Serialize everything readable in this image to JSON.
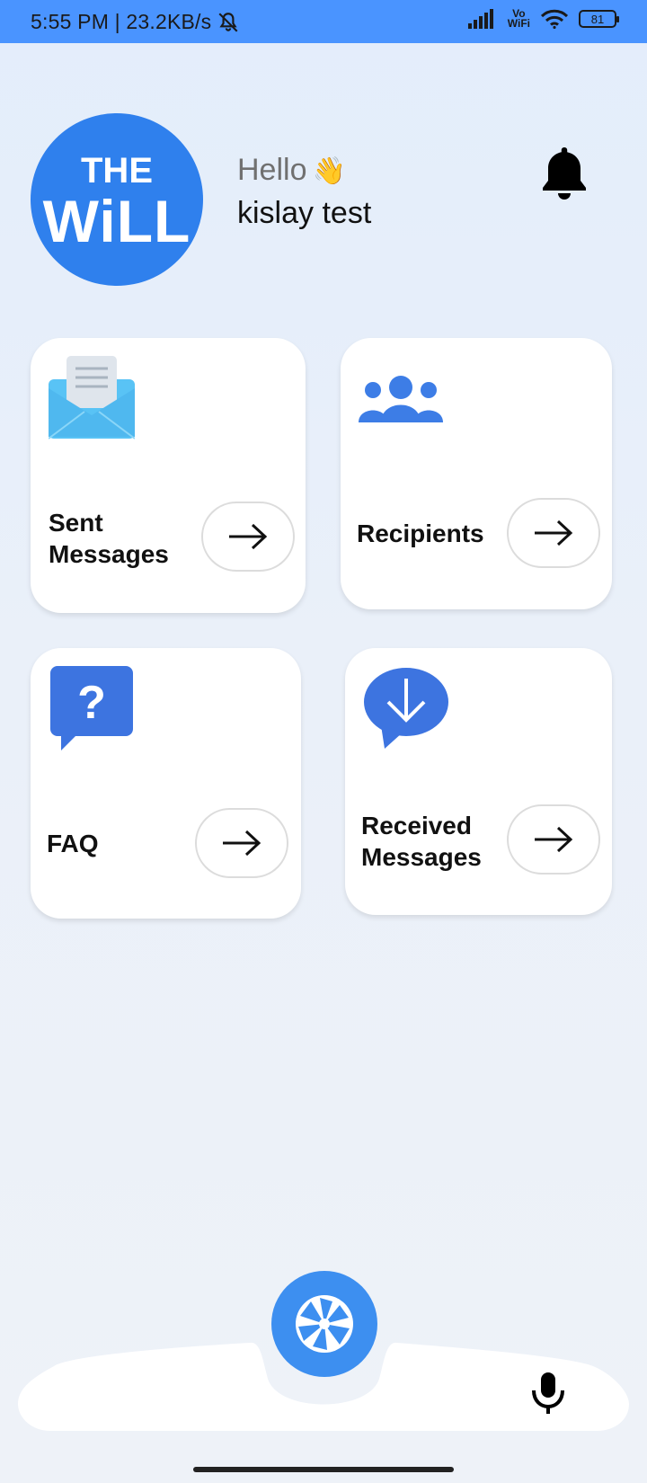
{
  "status": {
    "time_speed": "5:55 PM | 23.2KB/s",
    "vowifi_top": "Vo",
    "vowifi_bottom": "WiFi",
    "battery": "81"
  },
  "logo": {
    "line1": "THE",
    "line2": "WiLL"
  },
  "header": {
    "greeting": "Hello",
    "wave": "👋",
    "username": "kislay test"
  },
  "cards": {
    "sent": {
      "label_line1": "Sent",
      "label_line2": "Messages"
    },
    "recipients": {
      "label": "Recipients"
    },
    "faq": {
      "label": "FAQ"
    },
    "received": {
      "label_line1": "Received",
      "label_line2": "Messages"
    }
  },
  "icons": {
    "bell": "bell-icon",
    "sent": "envelope-open-icon",
    "recipients": "group-icon",
    "faq": "question-bubble-icon",
    "received": "download-bubble-icon",
    "fab": "camera-shutter-icon",
    "mic": "microphone-icon"
  },
  "colors": {
    "accent": "#2f80ed",
    "status_bar": "#4a94ff",
    "fab": "#3d8ff0"
  }
}
